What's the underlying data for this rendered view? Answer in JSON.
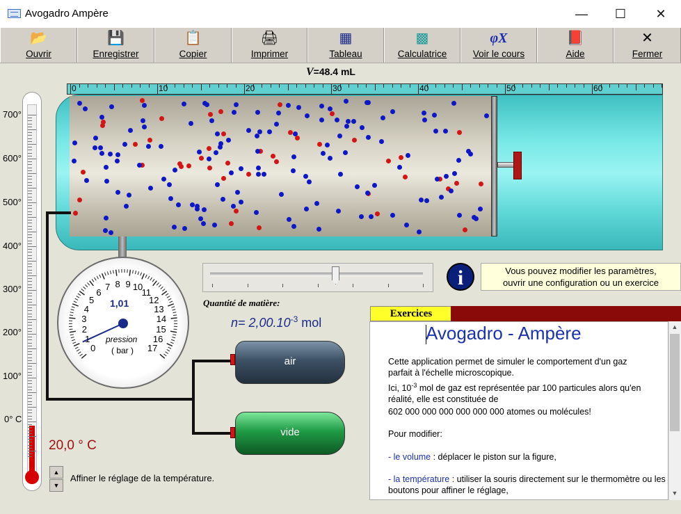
{
  "window": {
    "title": "Avogadro Ampère",
    "minimize": "—",
    "maximize": "☐",
    "close": "✕"
  },
  "toolbar": [
    {
      "label": "Ouvrir",
      "icon": "📂"
    },
    {
      "label": "Enregistrer",
      "icon": "💾"
    },
    {
      "label": "Copier",
      "icon": "📋"
    },
    {
      "label": "Imprimer",
      "icon": "🖨"
    },
    {
      "label": "Tableau",
      "icon": "▦"
    },
    {
      "label": "Calculatrice",
      "icon": "▩"
    },
    {
      "label": "Voir le cours",
      "icon": "φX"
    },
    {
      "label": "Aide",
      "icon": "📕"
    },
    {
      "label": "Fermer",
      "icon": "✕"
    }
  ],
  "volume": {
    "symbol": "V",
    "text": "=48.4 mL",
    "value_ml": 48.4
  },
  "ruler": {
    "labels": [
      "0",
      "10",
      "20",
      "30",
      "40",
      "50",
      "60"
    ]
  },
  "thermometer": {
    "labels": [
      "700°",
      "600°",
      "500°",
      "400°",
      "300°",
      "200°",
      "100°",
      "0° C"
    ],
    "temperature": "20,0 ° C",
    "fine_tune_label": "Affiner le réglage de la température.",
    "spin_up": "▲",
    "spin_down": "▼"
  },
  "gauge": {
    "value": "1,01",
    "label_pressure": "pression",
    "label_unit": "( bar )",
    "numbers": [
      "0",
      "1",
      "2",
      "3",
      "4",
      "5",
      "6",
      "7",
      "8",
      "9",
      "10",
      "11",
      "12",
      "13",
      "14",
      "15",
      "16",
      "17"
    ],
    "pressure_bar": 1.01
  },
  "slider": {
    "position_fraction": 0.6
  },
  "info": {
    "icon": "i",
    "line1": "Vous pouvez modifier les paramètres,",
    "line2": "ouvrir une configuration ou un exercice"
  },
  "quantity": {
    "label": "Quantité de matière:",
    "prefix": "n= 2,00.10",
    "exponent": "-3",
    "unit": " mol"
  },
  "bottles": [
    {
      "label": "air",
      "color": "#3c4f62"
    },
    {
      "label": "vide",
      "color": "#1f8a3c"
    }
  ],
  "exercises": {
    "tab": "Exercices",
    "title": "Avogadro - Ampère",
    "p1": "Cette application permet de simuler le comportement d'un gaz parfait à l'échelle microscopique.",
    "p2a": "Ici, 10",
    "p2sup": "-3",
    "p2b": " mol de gaz est représentée par 100 particules alors qu'en réalité, elle est constituée de",
    "p3": "602 000 000 000 000 000 000 atomes ou molécules!",
    "p4": "Pour modifier:",
    "p5a": "- le volume",
    "p5b": " : déplacer le piston sur la figure,",
    "p6a": "- la température",
    "p6b": " : utiliser la souris directement sur le thermomètre ou les boutons pour affiner le réglage,"
  },
  "scrollbar": {
    "up": "▲",
    "down": "▼"
  }
}
